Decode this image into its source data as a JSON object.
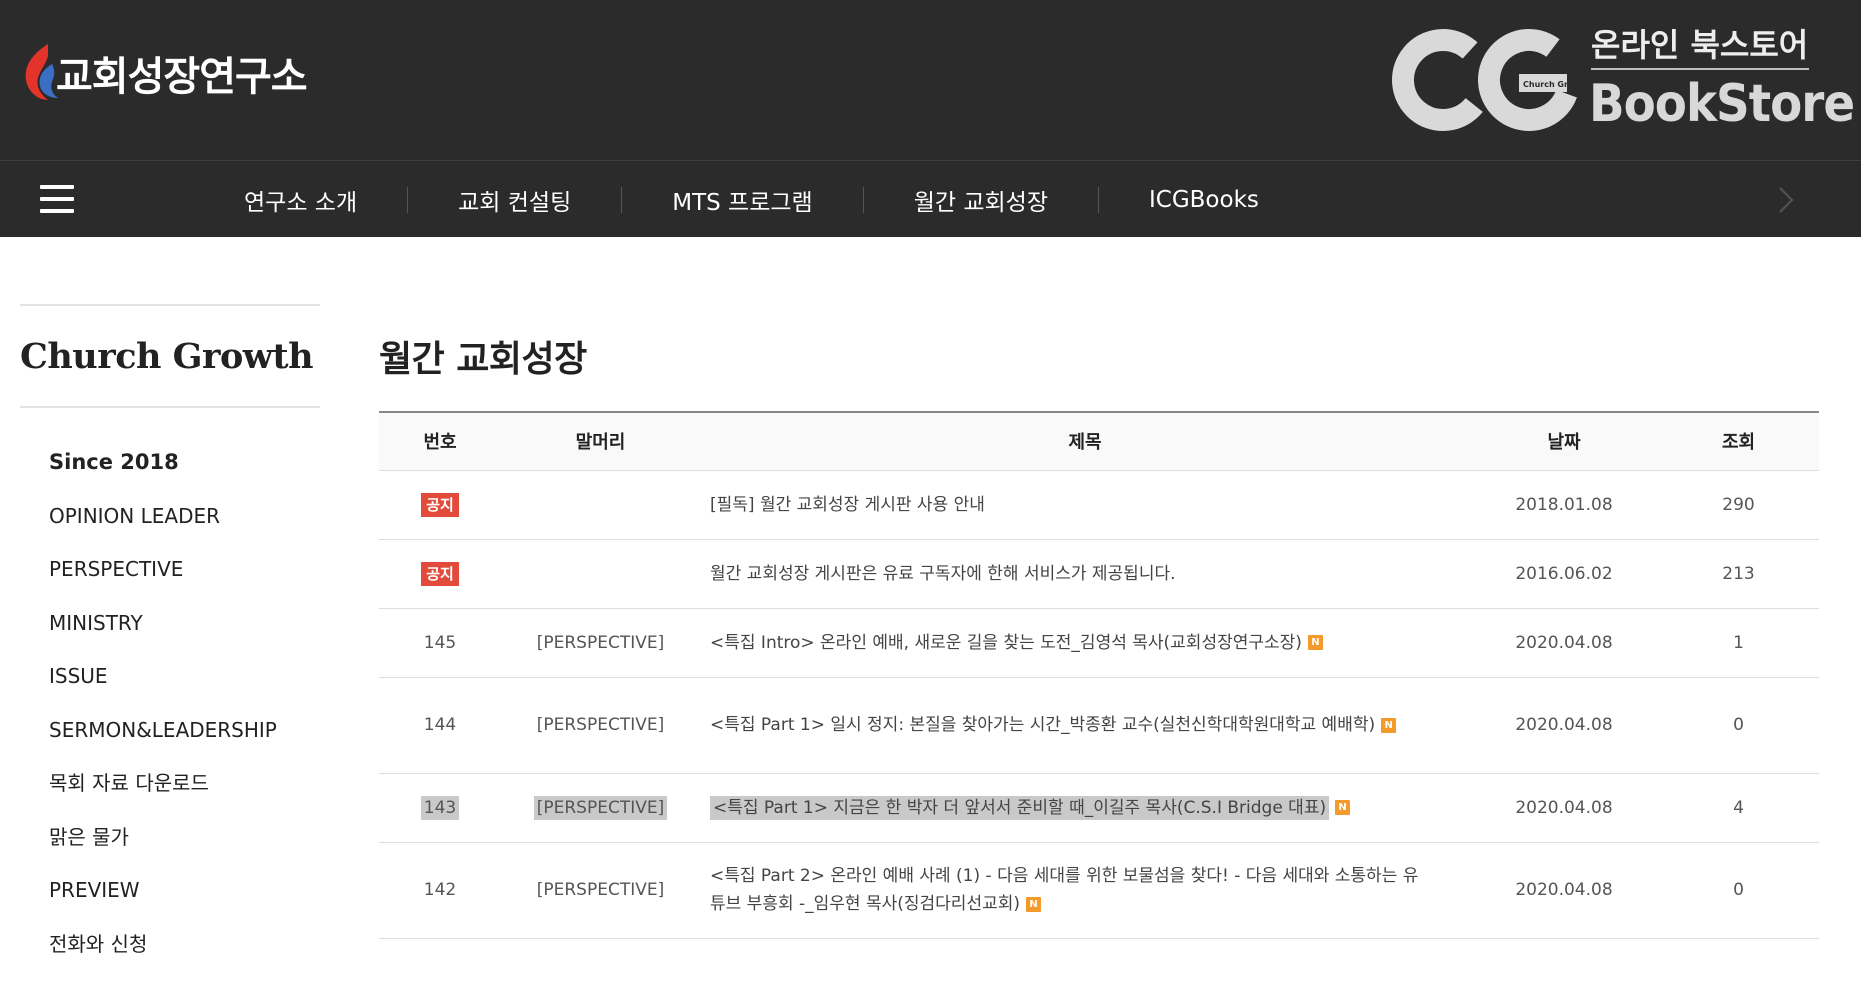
{
  "header": {
    "logo_text": "교회성장연구소",
    "bookstore_sub": "온라인 북스토어",
    "bookstore_name": "BookStore",
    "badge_text": "Church Growth",
    "colors": {
      "bg": "#2b2b2b",
      "flame_red": "#e2342b",
      "flame_blue": "#3a6fc4"
    }
  },
  "nav": {
    "items": [
      {
        "label": "연구소 소개"
      },
      {
        "label": "교회 컨설팅"
      },
      {
        "label": "MTS 프로그램"
      },
      {
        "label": "월간 교회성장"
      },
      {
        "label": "ICGBooks"
      }
    ]
  },
  "sidebar": {
    "title": "Church Growth",
    "items": [
      {
        "label": "Since 2018"
      },
      {
        "label": "OPINION LEADER"
      },
      {
        "label": "PERSPECTIVE"
      },
      {
        "label": "MINISTRY"
      },
      {
        "label": "ISSUE"
      },
      {
        "label": "SERMON&LEADERSHIP"
      },
      {
        "label": "목회 자료 다운로드"
      },
      {
        "label": "맑은 물가"
      },
      {
        "label": "PREVIEW"
      },
      {
        "label": "전화와 신청"
      }
    ]
  },
  "main": {
    "title": "월간 교회성장",
    "columns": {
      "no": "번호",
      "prefix": "말머리",
      "title": "제목",
      "date": "날짜",
      "views": "조회"
    },
    "notice_label": "공지",
    "new_label": "N",
    "rows": [
      {
        "no": "공지",
        "prefix": "",
        "title": "[필독] 월간 교회성장 게시판 사용 안내",
        "date": "2018.01.08",
        "views": "290"
      },
      {
        "no": "공지",
        "prefix": "",
        "title": "월간 교회성장 게시판은 유료 구독자에 한해 서비스가 제공됩니다.",
        "date": "2016.06.02",
        "views": "213"
      },
      {
        "no": "145",
        "prefix": "[PERSPECTIVE]",
        "title": "<특집 Intro> 온라인 예배, 새로운 길을 찾는 도전_김영석 목사(교회성장연구소장)",
        "date": "2020.04.08",
        "views": "1"
      },
      {
        "no": "144",
        "prefix": "[PERSPECTIVE]",
        "title": "<특집 Part 1> 일시 정지: 본질을 찾아가는 시간_박종환 교수(실천신학대학원대학교 예배학)",
        "date": "2020.04.08",
        "views": "0"
      },
      {
        "no": "143",
        "prefix": "[PERSPECTIVE]",
        "title": "<특집 Part 1> 지금은 한 박자 더 앞서서 준비할 때_이길주 목사(C.S.I Bridge 대표)",
        "date": "2020.04.08",
        "views": "4"
      },
      {
        "no": "142",
        "prefix": "[PERSPECTIVE]",
        "title": "<특집 Part 2> 온라인 예배 사례 (1) - 다음 세대를 위한 보물섬을 찾다! - 다음 세대와 소통하는 유튜브 부흥회 -_임우현 목사(징검다리선교회)",
        "date": "2020.04.08",
        "views": "0"
      }
    ]
  }
}
